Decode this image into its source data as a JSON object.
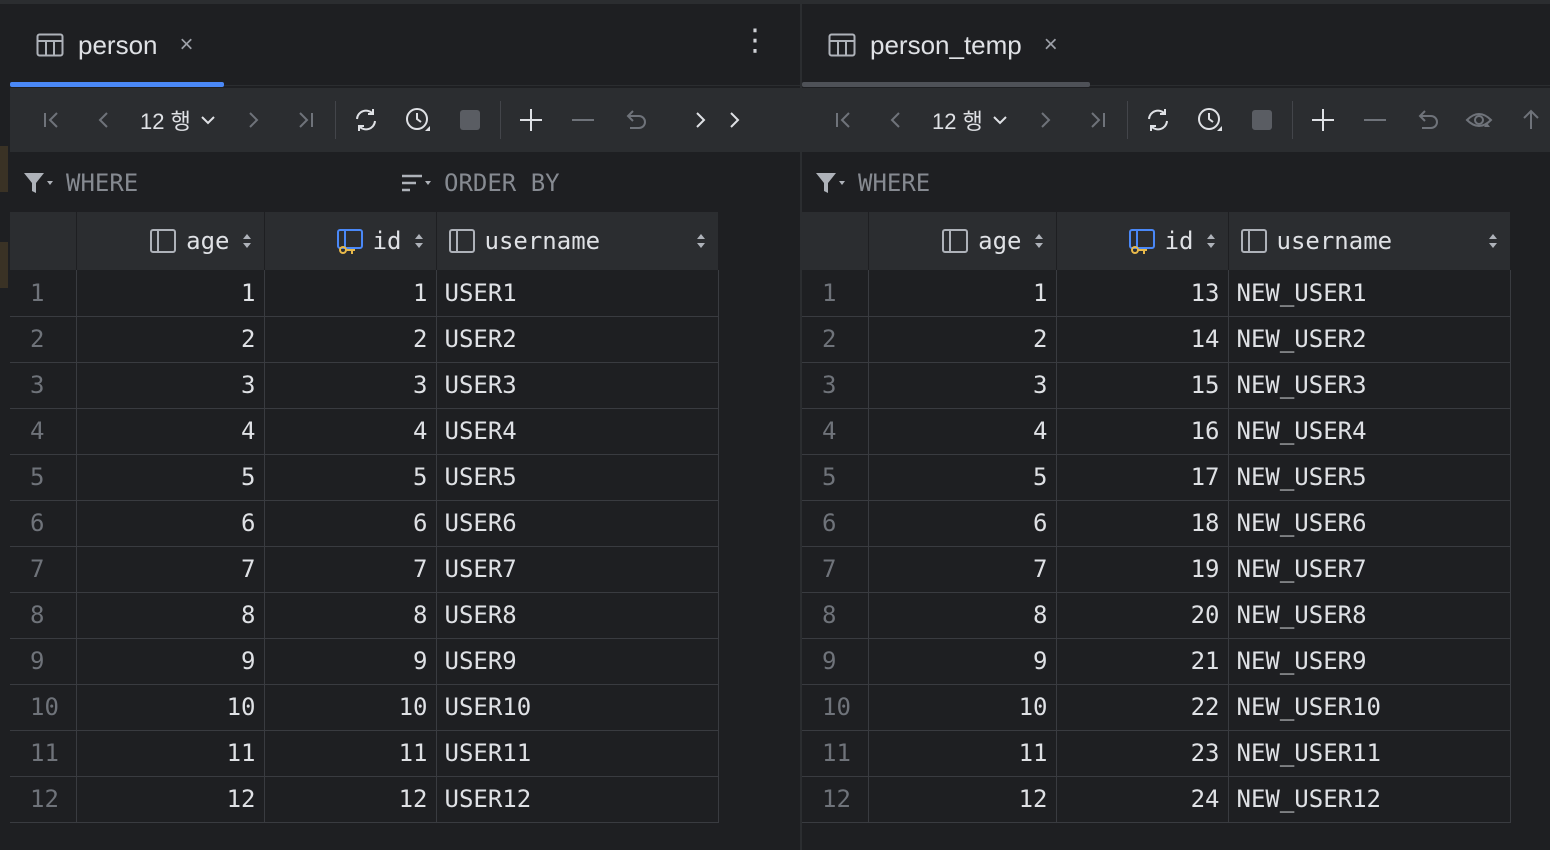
{
  "colors": {
    "accent": "#4a88f7",
    "bg": "#1e1f22",
    "toolbar": "#2b2d30",
    "key_icon": "#e8b94a"
  },
  "left": {
    "tab": {
      "label": "person",
      "close": "×"
    },
    "more_menu": "⋮",
    "rows_label": "12 행",
    "filters": {
      "where": "WHERE",
      "order_by": "ORDER BY"
    },
    "columns": [
      "age",
      "id",
      "username"
    ],
    "rows": [
      [
        "1",
        "1",
        "1",
        "USER1"
      ],
      [
        "2",
        "2",
        "2",
        "USER2"
      ],
      [
        "3",
        "3",
        "3",
        "USER3"
      ],
      [
        "4",
        "4",
        "4",
        "USER4"
      ],
      [
        "5",
        "5",
        "5",
        "USER5"
      ],
      [
        "6",
        "6",
        "6",
        "USER6"
      ],
      [
        "7",
        "7",
        "7",
        "USER7"
      ],
      [
        "8",
        "8",
        "8",
        "USER8"
      ],
      [
        "9",
        "9",
        "9",
        "USER9"
      ],
      [
        "10",
        "10",
        "10",
        "USER10"
      ],
      [
        "11",
        "11",
        "11",
        "USER11"
      ],
      [
        "12",
        "12",
        "12",
        "USER12"
      ]
    ]
  },
  "right": {
    "tab": {
      "label": "person_temp",
      "close": "×"
    },
    "rows_label": "12 행",
    "filters": {
      "where": "WHERE"
    },
    "columns": [
      "age",
      "id",
      "username"
    ],
    "rows": [
      [
        "1",
        "1",
        "13",
        "NEW_USER1"
      ],
      [
        "2",
        "2",
        "14",
        "NEW_USER2"
      ],
      [
        "3",
        "3",
        "15",
        "NEW_USER3"
      ],
      [
        "4",
        "4",
        "16",
        "NEW_USER4"
      ],
      [
        "5",
        "5",
        "17",
        "NEW_USER5"
      ],
      [
        "6",
        "6",
        "18",
        "NEW_USER6"
      ],
      [
        "7",
        "7",
        "19",
        "NEW_USER7"
      ],
      [
        "8",
        "8",
        "20",
        "NEW_USER8"
      ],
      [
        "9",
        "9",
        "21",
        "NEW_USER9"
      ],
      [
        "10",
        "10",
        "22",
        "NEW_USER10"
      ],
      [
        "11",
        "11",
        "23",
        "NEW_USER11"
      ],
      [
        "12",
        "12",
        "24",
        "NEW_USER12"
      ]
    ]
  }
}
